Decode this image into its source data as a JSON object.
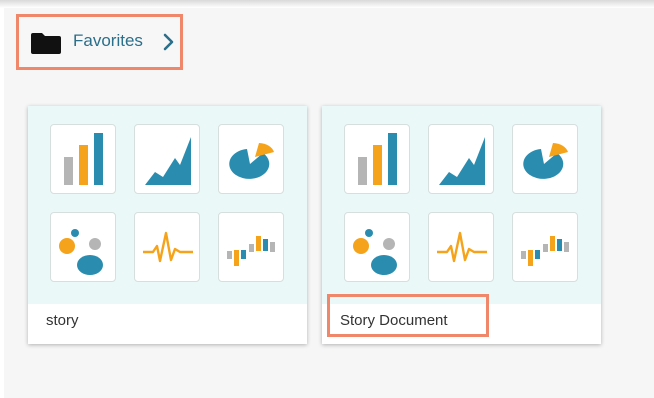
{
  "breadcrumb": {
    "folder_icon": "folder-icon",
    "label": "Favorites",
    "chevron_icon": "chevron-right-icon"
  },
  "cards": [
    {
      "title": "story",
      "icons": [
        "bar-chart-icon",
        "area-chart-icon",
        "pie-chart-icon",
        "bubble-chart-icon",
        "pulse-icon",
        "waterfall-chart-icon"
      ]
    },
    {
      "title": "Story Document",
      "icons": [
        "bar-chart-icon",
        "area-chart-icon",
        "pie-chart-icon",
        "bubble-chart-icon",
        "pulse-icon",
        "waterfall-chart-icon"
      ]
    }
  ],
  "colors": {
    "highlight_border": "#f0876a",
    "link_text": "#2b6f8a",
    "teal": "#2a8db0",
    "orange": "#f5a31b",
    "gray": "#b5b5b5",
    "thumb_bg": "#eaf8f8"
  }
}
